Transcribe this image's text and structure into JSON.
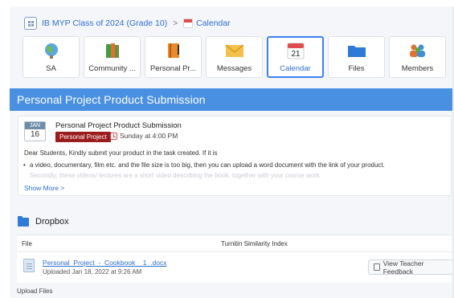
{
  "breadcrumb": {
    "course": "IB MYP Class of 2024 (Grade 10)",
    "separator": ">",
    "current": "Calendar"
  },
  "tiles": [
    {
      "label": "SA",
      "icon": "globe-icon"
    },
    {
      "label": "Community ...",
      "icon": "books-icon"
    },
    {
      "label": "Personal Pr...",
      "icon": "notebook-icon"
    },
    {
      "label": "Messages",
      "icon": "envelope-icon"
    },
    {
      "label": "Calendar",
      "icon": "calendar-icon",
      "day": "21",
      "active": true
    },
    {
      "label": "Files",
      "icon": "folder-icon"
    },
    {
      "label": "Members",
      "icon": "members-icon"
    }
  ],
  "page_title": "Personal Project Product Submission",
  "event": {
    "month": "JAN",
    "day": "16",
    "title": "Personal Project Product Submission",
    "tag": "Personal Project",
    "time": "Sunday at 4:00 PM",
    "body": "Dear Students, Kindly submit your product in the task created. If it is",
    "bullet": "a video, documentary, film etc. and the file size is too big, then you can upload a word document with the link of your product.",
    "faded": "Secondly, these videos/ lectures are a short video describing the book, together with your course work",
    "show_more": "Show More >"
  },
  "dropbox": {
    "title": "Dropbox",
    "col_file": "File",
    "col_turnitin": "Turnitin Similarity Index",
    "file_name": "Personal_Project_-_Cookbook__1_.docx",
    "uploaded": "Uploaded Jan 18, 2022 at 9:26 AM",
    "feedback_button": "View Teacher Feedback",
    "upload_label": "Upload Files"
  },
  "colors": {
    "accent": "#4a90e2",
    "tag": "#9b1c1c",
    "link": "#2f6fd0"
  }
}
